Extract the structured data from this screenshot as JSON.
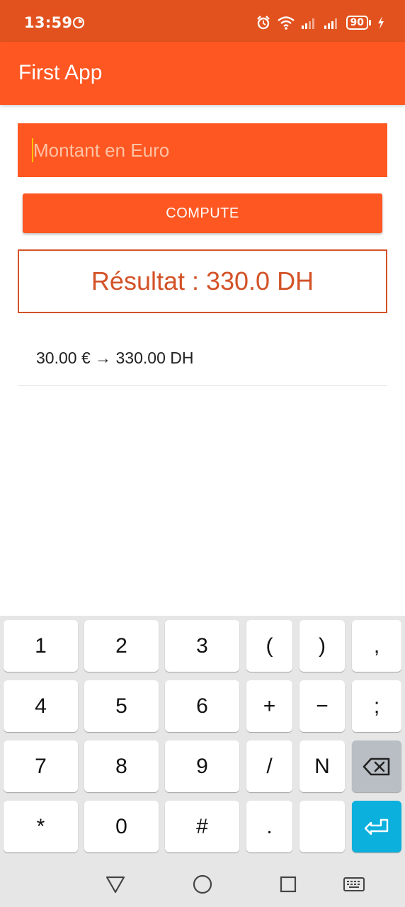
{
  "status_bar": {
    "time": "13:59",
    "battery": "90",
    "icons": [
      "alarm-icon",
      "wifi-icon",
      "signal-icon",
      "signal-icon",
      "battery-icon",
      "charging-icon"
    ]
  },
  "app_bar": {
    "title": "First App"
  },
  "form": {
    "input_placeholder": "Montant en Euro",
    "compute_label": "COMPUTE"
  },
  "result": {
    "text": "Résultat : 330.0 DH"
  },
  "history": [
    {
      "text": "30.00 € → 330.00 DH"
    }
  ],
  "keyboard": {
    "rows": [
      [
        "1",
        "2",
        "3",
        "(",
        ")",
        ","
      ],
      [
        "4",
        "5",
        "6",
        "+",
        "−",
        ";"
      ],
      [
        "7",
        "8",
        "9",
        "/",
        "N",
        ""
      ],
      [
        "*",
        "0",
        "#",
        ".",
        "",
        ""
      ]
    ]
  },
  "colors": {
    "status_bar": "#E2521E",
    "primary": "#FF5722",
    "result": "#D35227",
    "enter_key": "#0BB0DC"
  }
}
